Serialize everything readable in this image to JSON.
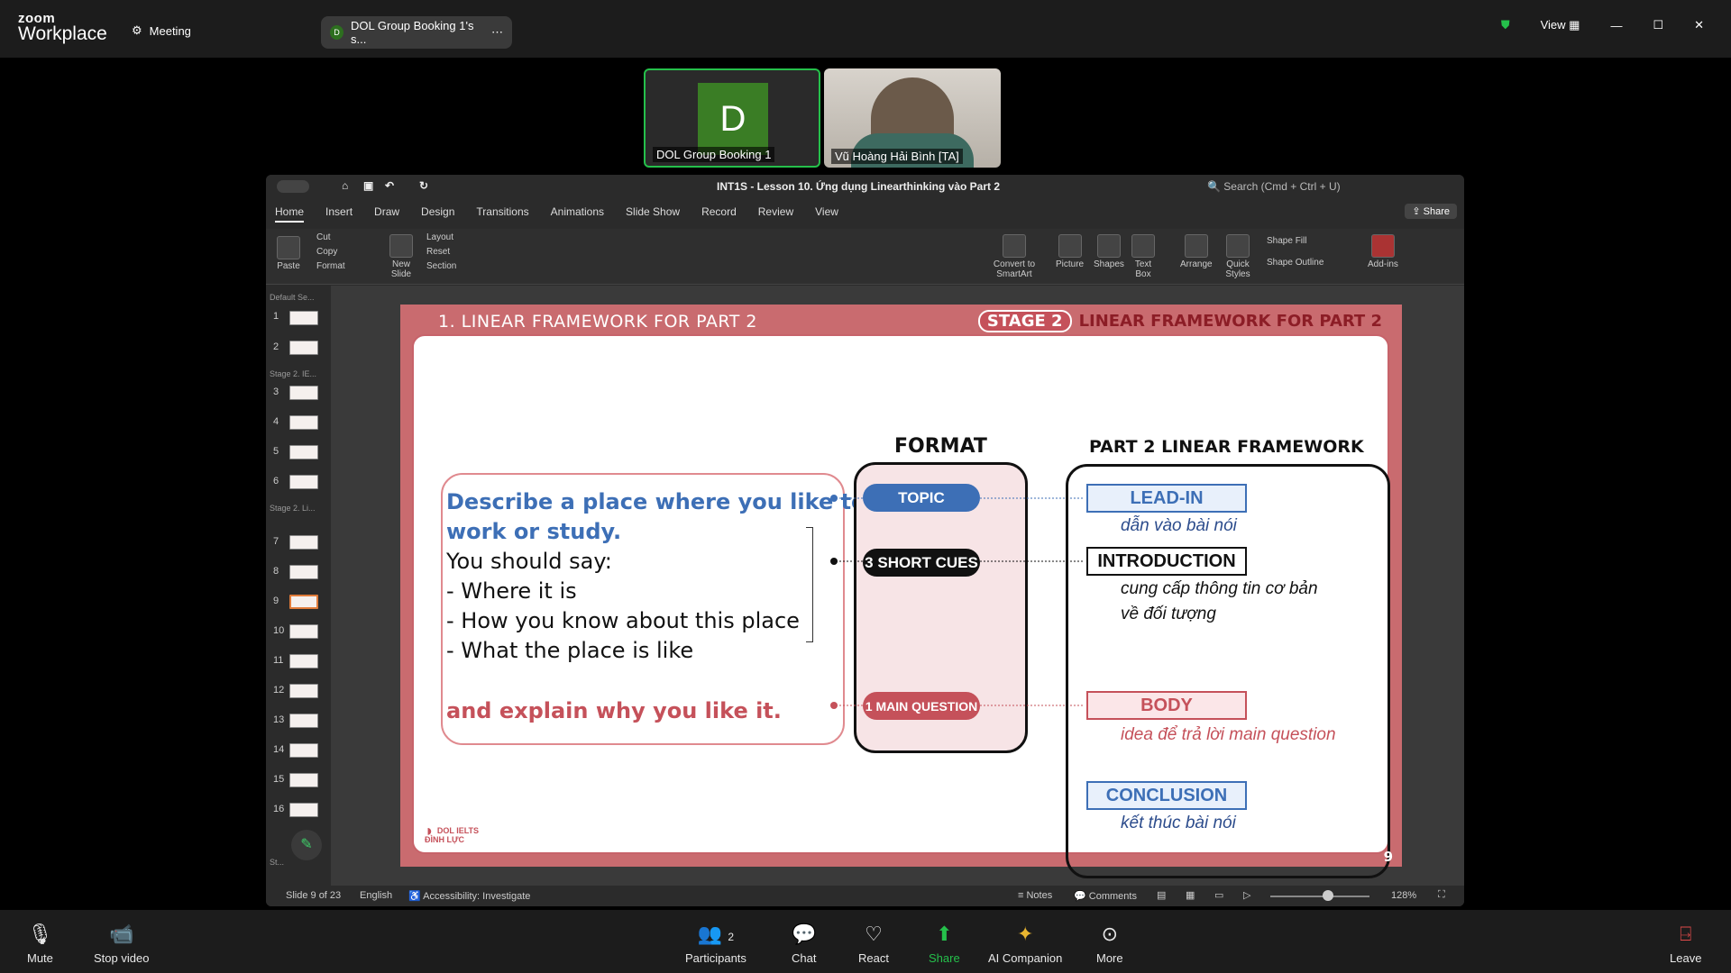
{
  "zoom": {
    "logo_top": "zoom",
    "logo_bottom": "Workplace",
    "meeting_label": "Meeting",
    "tab_initial": "D",
    "tab_title": "DOL Group Booking 1's s...",
    "view_label": "View"
  },
  "participants": [
    {
      "name": "DOL Group Booking 1",
      "initial": "D"
    },
    {
      "name": "Vũ Hoàng Hải Bình [TA]"
    }
  ],
  "ppt": {
    "title": "INT1S - Lesson 10. Ứng dụng Linearthinking vào Part 2",
    "search_placeholder": "Search (Cmd + Ctrl + U)",
    "share_label": "Share",
    "tabs": [
      "Home",
      "Insert",
      "Draw",
      "Design",
      "Transitions",
      "Animations",
      "Slide Show",
      "Record",
      "Review",
      "View"
    ],
    "ribbon": {
      "paste": "Paste",
      "cut": "Cut",
      "copy": "Copy",
      "format": "Format",
      "new_slide": "New Slide",
      "layout": "Layout",
      "reset": "Reset",
      "section": "Section",
      "convert": "Convert to SmartArt",
      "picture": "Picture",
      "shapes": "Shapes",
      "textbox": "Text Box",
      "arrange": "Arrange",
      "quick_styles": "Quick Styles",
      "shape_fill": "Shape Fill",
      "shape_outline": "Shape Outline",
      "addins": "Add-ins"
    },
    "sections": [
      "Default Se...",
      "Stage 2. IE...",
      "Stage 2. Li...",
      "St..."
    ],
    "slide_numbers": [
      "1",
      "2",
      "3",
      "4",
      "5",
      "6",
      "7",
      "8",
      "9",
      "10",
      "11",
      "12",
      "13",
      "14",
      "15",
      "16"
    ],
    "status": {
      "slide_of": "Slide 9 of 23",
      "language": "English",
      "accessibility": "Accessibility: Investigate",
      "notes": "Notes",
      "comments": "Comments",
      "zoom": "128%"
    }
  },
  "slide": {
    "header_left": "1. LINEAR FRAMEWORK FOR PART 2",
    "header_stage": "STAGE 2",
    "header_right": "LINEAR FRAMEWORK FOR PART 2",
    "cue_title_line1": "Describe a place where you like to",
    "cue_title_line2": "work or study.",
    "cue_should": "You should say:",
    "cue_items": [
      "- Where it is",
      "- How you know about this place",
      "- What the place is like"
    ],
    "cue_explain": "and explain why you like it.",
    "format_title": "FORMAT",
    "format_topic": "TOPIC",
    "format_cues": "3 SHORT CUES",
    "format_main": "1 MAIN QUESTION",
    "linear_title": "PART 2 LINEAR FRAMEWORK",
    "leadin": "LEAD-IN",
    "leadin_sub": "dẫn vào bài nói",
    "intro": "INTRODUCTION",
    "intro_sub1": "cung cấp thông tin cơ bản",
    "intro_sub2": "về đối tượng",
    "body": "BODY",
    "body_sub": "idea để trả lời main question",
    "conclusion": "CONCLUSION",
    "conclusion_sub": "kết thúc bài nói",
    "logo_text": "DOL IELTS ĐÌNH LỰC",
    "page": "9"
  },
  "bottom": {
    "mute": "Mute",
    "stop_video": "Stop video",
    "participants": "Participants",
    "participants_count": "2",
    "chat": "Chat",
    "react": "React",
    "share": "Share",
    "ai": "AI Companion",
    "more": "More",
    "leave": "Leave"
  },
  "colors": {
    "accent_green": "#25c04b",
    "slide_red": "#c96b6f",
    "topic_blue": "#3d6fb6",
    "main_red": "#c5515a"
  }
}
